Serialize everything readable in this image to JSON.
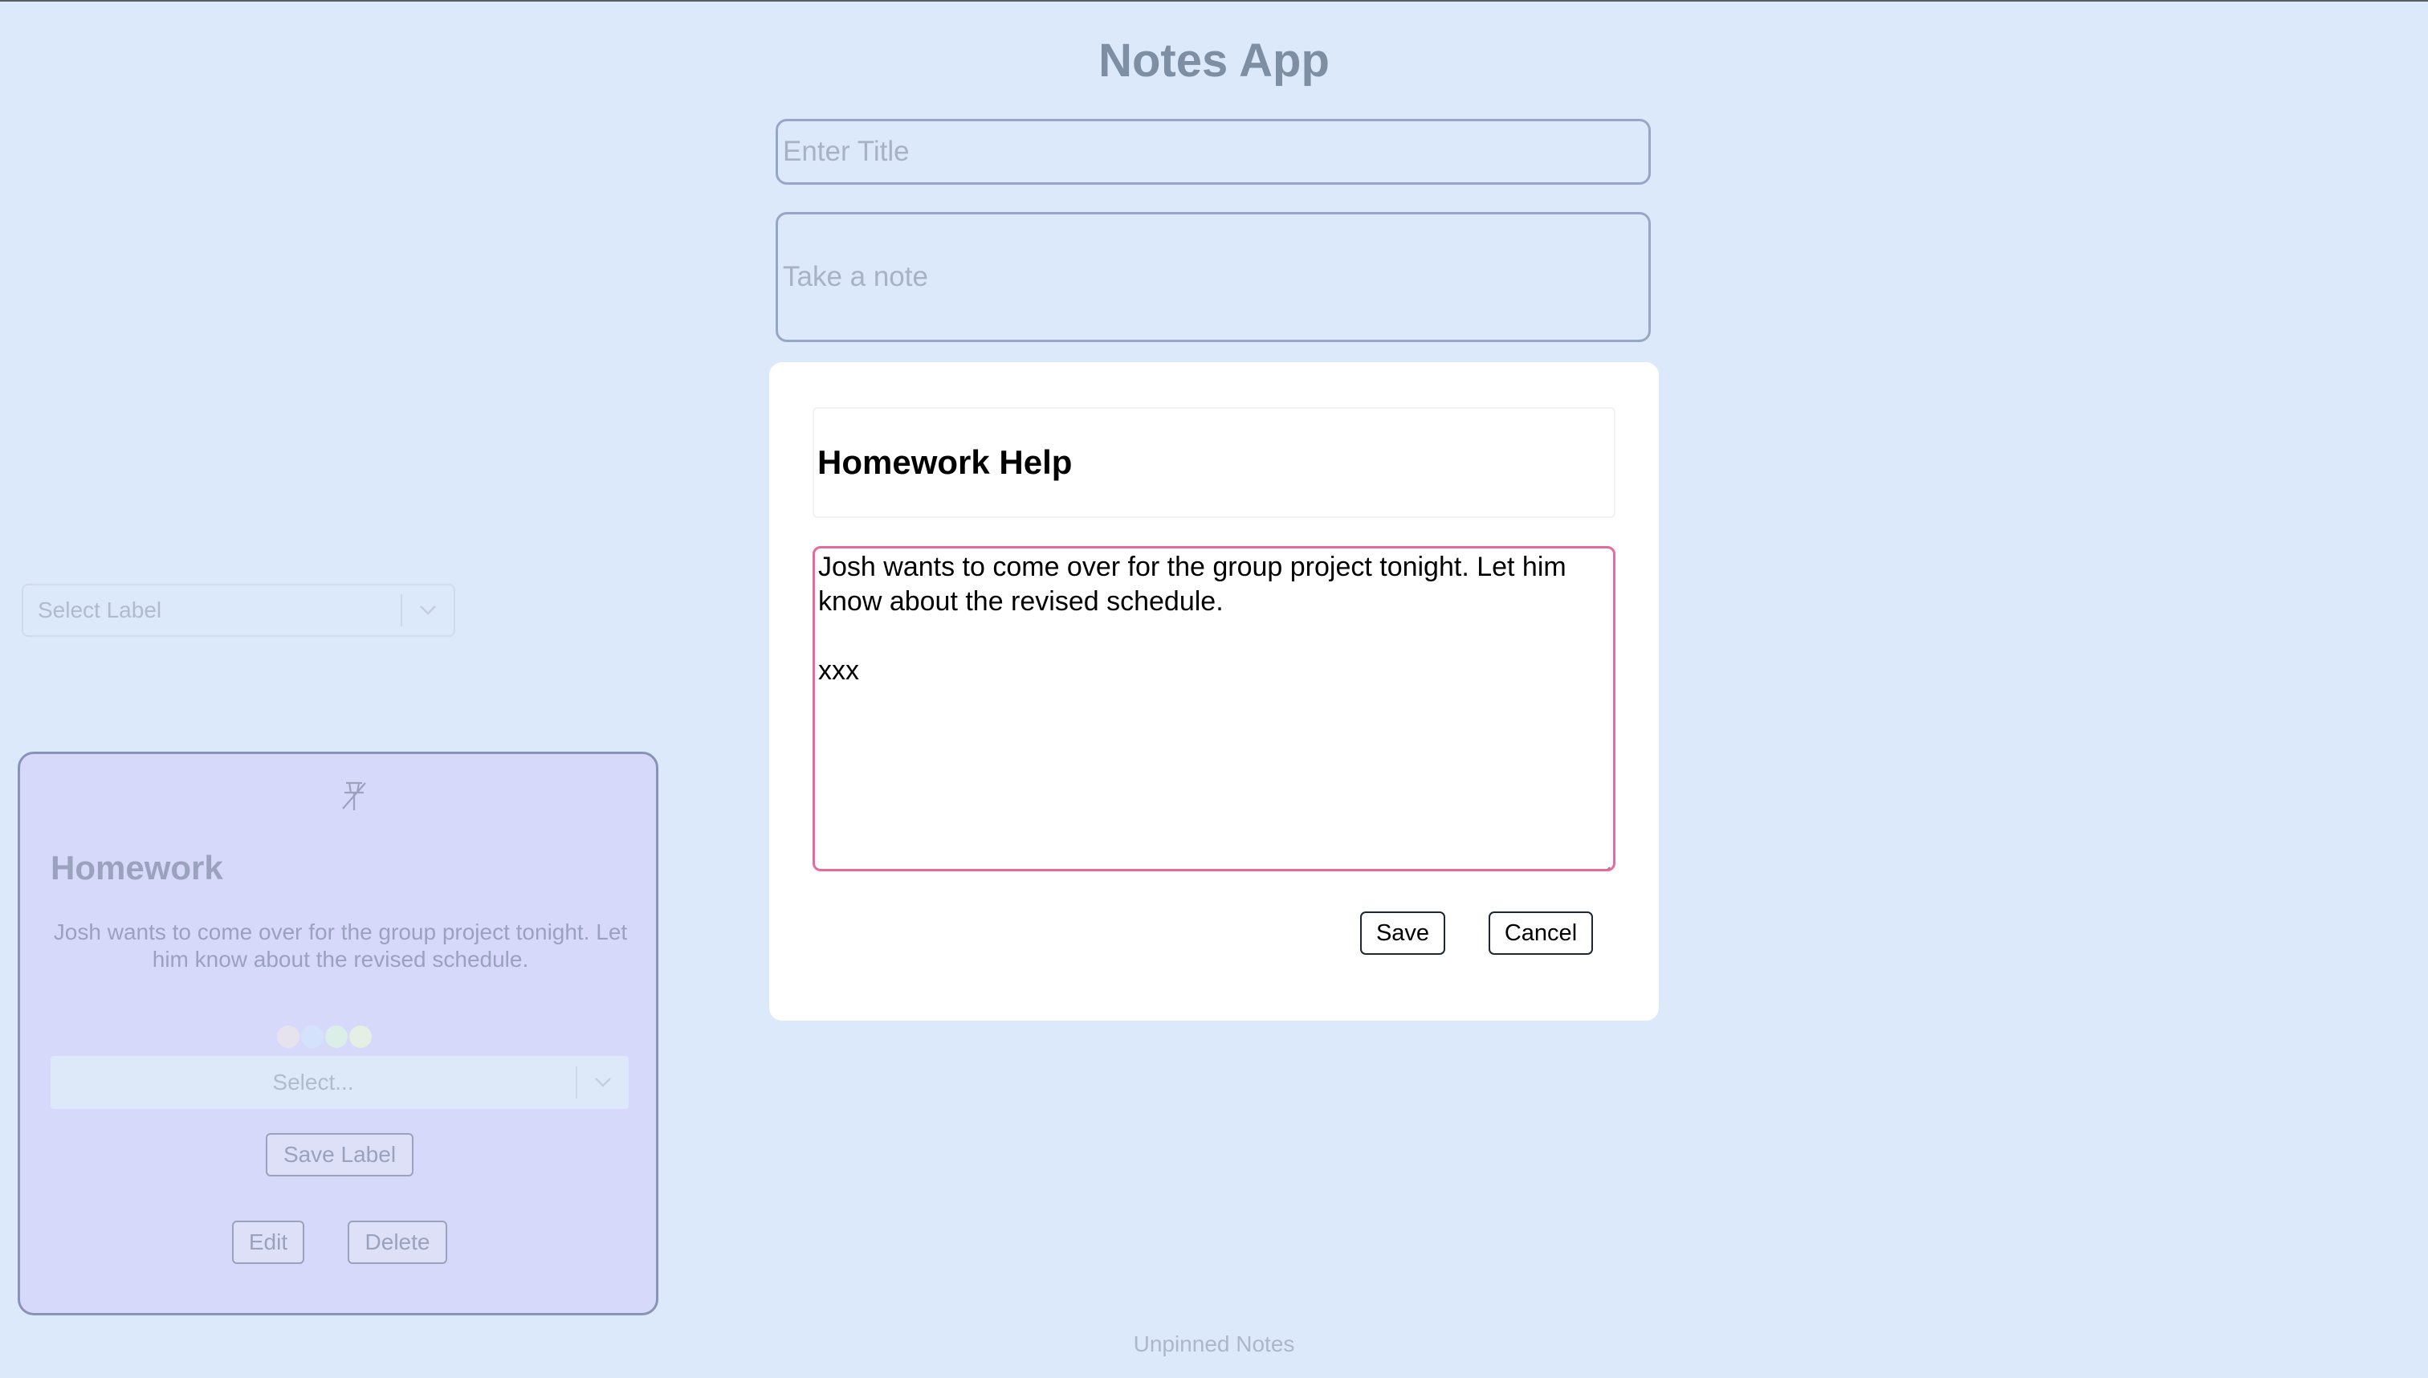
{
  "app": {
    "title": "Notes App"
  },
  "new_note": {
    "title_placeholder": "Enter Title",
    "body_placeholder": "Take a note"
  },
  "label_filter": {
    "placeholder": "Select Label"
  },
  "note_card": {
    "title": "Homework",
    "text": "Josh wants to come over for the group project tonight. Let him know about the revised schedule.",
    "colors": [
      "#e6e3ee",
      "#d4e3fb",
      "#dbeee8",
      "#e4f0e3"
    ],
    "label_select_placeholder": "Select...",
    "save_label_button": "Save Label",
    "edit_button": "Edit",
    "delete_button": "Delete"
  },
  "section": {
    "unpinned_label": "Unpinned Notes"
  },
  "edit_modal": {
    "title_value": "Homework Help",
    "body_value": "Josh wants to come over for the group project tonight. Let him know about the revised schedule.\n\nxxx",
    "save_button": "Save",
    "cancel_button": "Cancel",
    "focus_color": "#e66a9e"
  }
}
